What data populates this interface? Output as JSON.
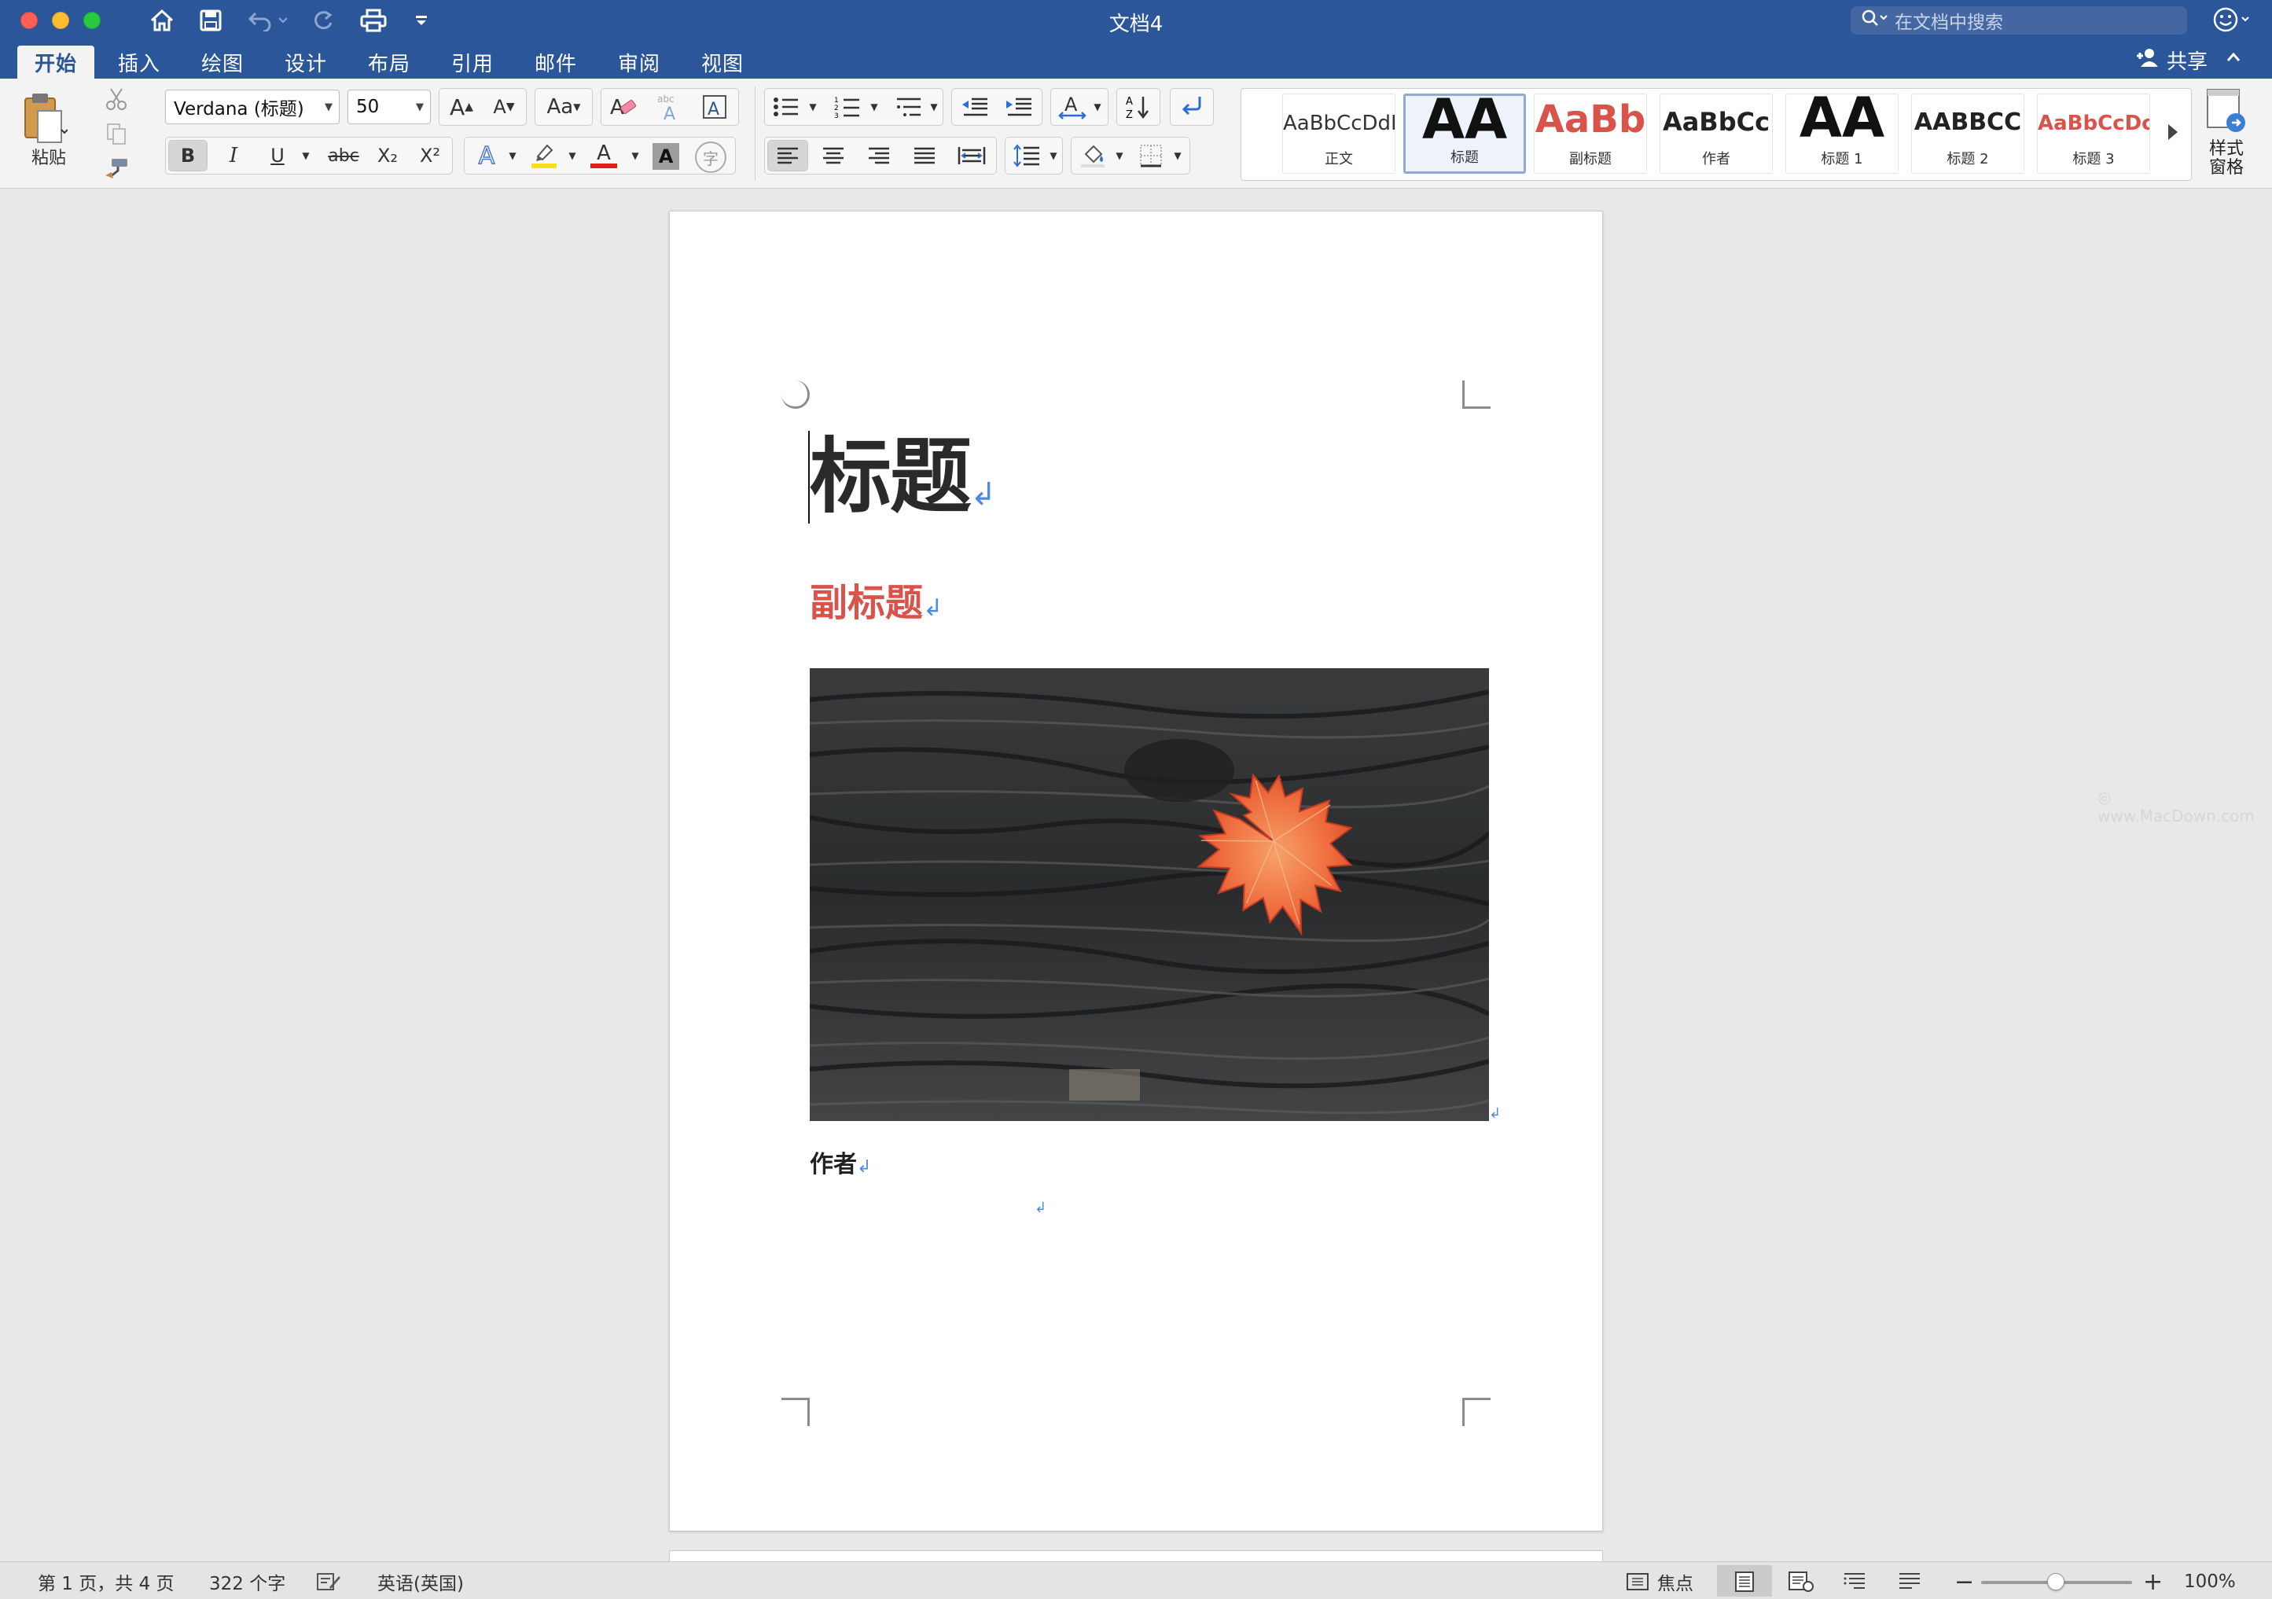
{
  "window": {
    "title": "文档4",
    "search_placeholder": "在文档中搜索"
  },
  "tabs": [
    {
      "label": "开始",
      "active": true
    },
    {
      "label": "插入",
      "active": false
    },
    {
      "label": "绘图",
      "active": false
    },
    {
      "label": "设计",
      "active": false
    },
    {
      "label": "布局",
      "active": false
    },
    {
      "label": "引用",
      "active": false
    },
    {
      "label": "邮件",
      "active": false
    },
    {
      "label": "审阅",
      "active": false
    },
    {
      "label": "视图",
      "active": false
    }
  ],
  "share_label": "共享",
  "ribbon": {
    "paste_label": "粘贴",
    "font_name": "Verdana (标题)",
    "font_size": "50",
    "bold": "B",
    "italic": "I",
    "underline": "U",
    "strike": "abc",
    "subscript": "X₂",
    "superscript": "X²",
    "text_effects": "A",
    "font_color_letter": "A",
    "char_shading": "A",
    "phonetic": "字",
    "highlight_color": "#f5e01a",
    "font_color": "#e02020",
    "styles_pane_label": "样式\n窗格",
    "styles": [
      {
        "preview": "AaBbCcDdE",
        "name": "正文",
        "selected": false,
        "color": "#333333"
      },
      {
        "preview": "AA",
        "name": "标题",
        "selected": true,
        "color": "#111111"
      },
      {
        "preview": "AaBb",
        "name": "副标题",
        "selected": false,
        "color": "#d9534a"
      },
      {
        "preview": "AaBbCc",
        "name": "作者",
        "selected": false,
        "color": "#222222"
      },
      {
        "preview": "AA",
        "name": "标题 1",
        "selected": false,
        "color": "#111111"
      },
      {
        "preview": "AABBCC",
        "name": "标题 2",
        "selected": false,
        "color": "#222222"
      },
      {
        "preview": "AaBbCcDc",
        "name": "标题 3",
        "selected": false,
        "color": "#d9534a"
      }
    ]
  },
  "document": {
    "title": "标题",
    "subtitle": "副标题",
    "author": "作者",
    "paragraph_mark": "↲",
    "image_alt": "red maple leaf on charred wood"
  },
  "watermark": "www.MacDown.com",
  "status": {
    "page": "第 1 页，共 4 页",
    "words": "322 个字",
    "language": "英语(英国)",
    "focus": "焦点",
    "zoom": "100%",
    "zoom_value": 100
  }
}
